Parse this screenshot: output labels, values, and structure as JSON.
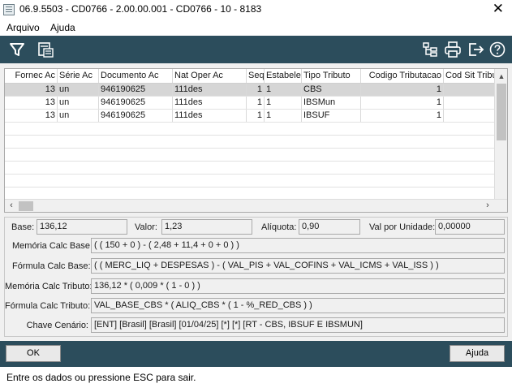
{
  "window": {
    "title": "06.9.5503 - CD0766 - 2.00.00.001 - CD0766 - 10 - 8183",
    "close_glyph": "✕"
  },
  "menu": {
    "items": [
      "Arquivo",
      "Ajuda"
    ]
  },
  "toolbar": {
    "left_icons": [
      "filter-icon",
      "calculator-icon"
    ],
    "right_icons": [
      "tree-icon",
      "print-icon",
      "exit-icon",
      "help-icon"
    ]
  },
  "grid": {
    "columns": [
      "Fornec Ac",
      "Série Ac",
      "Documento Ac",
      "Nat Oper Ac",
      "Seq",
      "Estabelec",
      "Tipo Tributo",
      "Codigo Tributacao",
      "Cod Sit Tribu"
    ],
    "rows": [
      [
        "13",
        "un",
        "946190625",
        "111des",
        "1",
        "1",
        "CBS",
        "1",
        ""
      ],
      [
        "13",
        "un",
        "946190625",
        "111des",
        "1",
        "1",
        "IBSMun",
        "1",
        ""
      ],
      [
        "13",
        "un",
        "946190625",
        "111des",
        "1",
        "1",
        "IBSUF",
        "1",
        ""
      ]
    ],
    "selected_row": 0,
    "scroll_left_glyph": "‹",
    "scroll_right_glyph": "›",
    "scroll_up_glyph": "▲",
    "scroll_down_glyph": "▼"
  },
  "form": {
    "base_label": "Base:",
    "base_value": "136,12",
    "valor_label": "Valor:",
    "valor_value": "1,23",
    "aliquota_label": "Alíquota:",
    "aliquota_value": "0,90",
    "val_unidade_label": "Val por Unidade:",
    "val_unidade_value": "0,00000",
    "memoria_base_label": "Memória Calc Base:",
    "memoria_base_value": "( ( 150 + 0 ) - ( 2,48 + 11,4 + 0 + 0 ) )",
    "formula_base_label": "Fórmula Calc Base:",
    "formula_base_value": "( ( MERC_LIQ + DESPESAS ) - ( VAL_PIS + VAL_COFINS + VAL_ICMS + VAL_ISS ) )",
    "memoria_tributo_label": "Memória Calc Tributo:",
    "memoria_tributo_value": "136,12 * ( 0,009 * ( 1 - 0 ) )",
    "formula_tributo_label": "Fórmula Calc Tributo:",
    "formula_tributo_value": "VAL_BASE_CBS * ( ALIQ_CBS * ( 1 - %_RED_CBS ) )",
    "chave_label": "Chave Cenário:",
    "chave_value": "[ENT] [Brasil] [Brasil] [01/04/25] [*] [*] [RT - CBS, IBSUF E IBSMUN]"
  },
  "buttons": {
    "ok": "OK",
    "ajuda": "Ajuda"
  },
  "status": {
    "text": "Entre os dados ou pressione ESC para sair."
  }
}
